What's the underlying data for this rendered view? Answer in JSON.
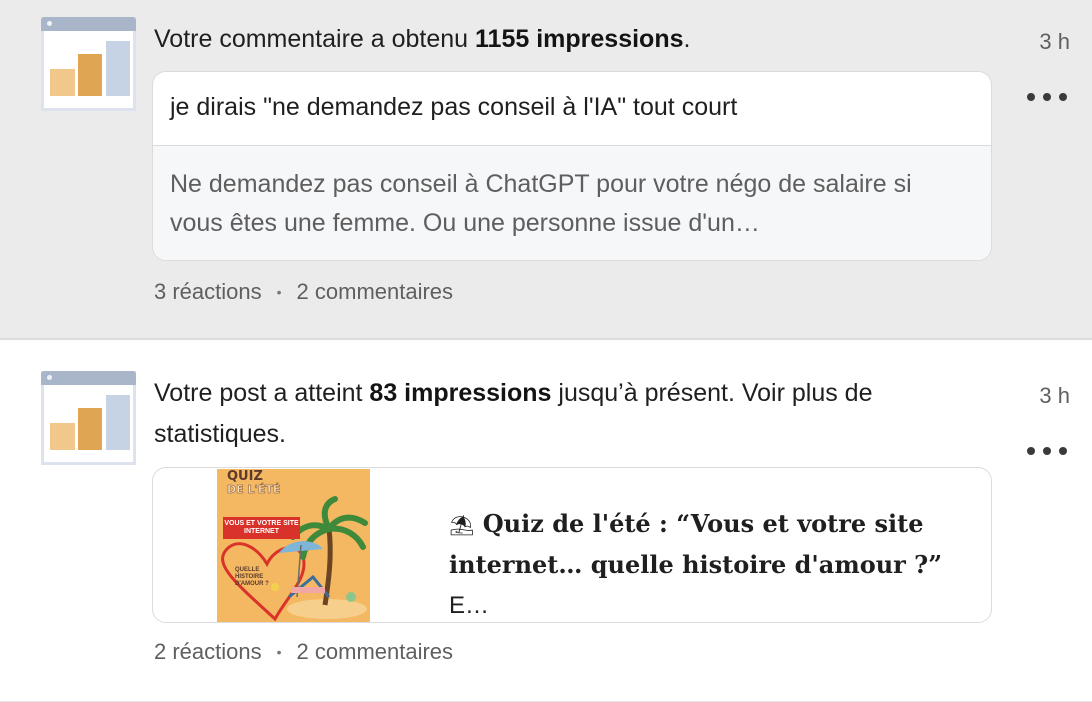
{
  "notifications": [
    {
      "headline_prefix": "Votre commentaire a obtenu ",
      "headline_bold": "1155 impressions",
      "headline_suffix": ".",
      "time": "3 h",
      "comment": "je dirais \"ne demandez pas conseil à l'IA\" tout court",
      "quoted_post": "Ne demandez pas conseil à ChatGPT pour votre négo de salaire si vous êtes une femme. Ou une personne issue d'un…",
      "reactions": "3 réactions",
      "separator": "•",
      "comments": "2 commentaires"
    },
    {
      "headline_prefix": "Votre post a atteint ",
      "headline_bold": "83 impressions",
      "headline_suffix": " jusqu’à présent. Voir plus de statistiques.",
      "time": "3 h",
      "post_emoji": "⛱",
      "post_title": "Quiz de l'été : “Vous et votre site internet… quelle histoire d'amour ?” ",
      "post_title_tail": "E…",
      "thumbnail": {
        "title": "QUIZ",
        "subtitle": "DE L'ÉTÉ",
        "tag": "VOUS ET VOTRE SITE INTERNET",
        "heart_text": "QUELLE HISTOIRE D'AMOUR ?"
      },
      "reactions": "2 réactions",
      "separator": "•",
      "comments": "2 commentaires"
    }
  ],
  "colors": {
    "bar_light": "#f2c78c",
    "bar_mid": "#e0a552",
    "bar_blue": "#c5d3e5",
    "thumb_bg": "#f4b862",
    "heart_red": "#d9322a"
  }
}
